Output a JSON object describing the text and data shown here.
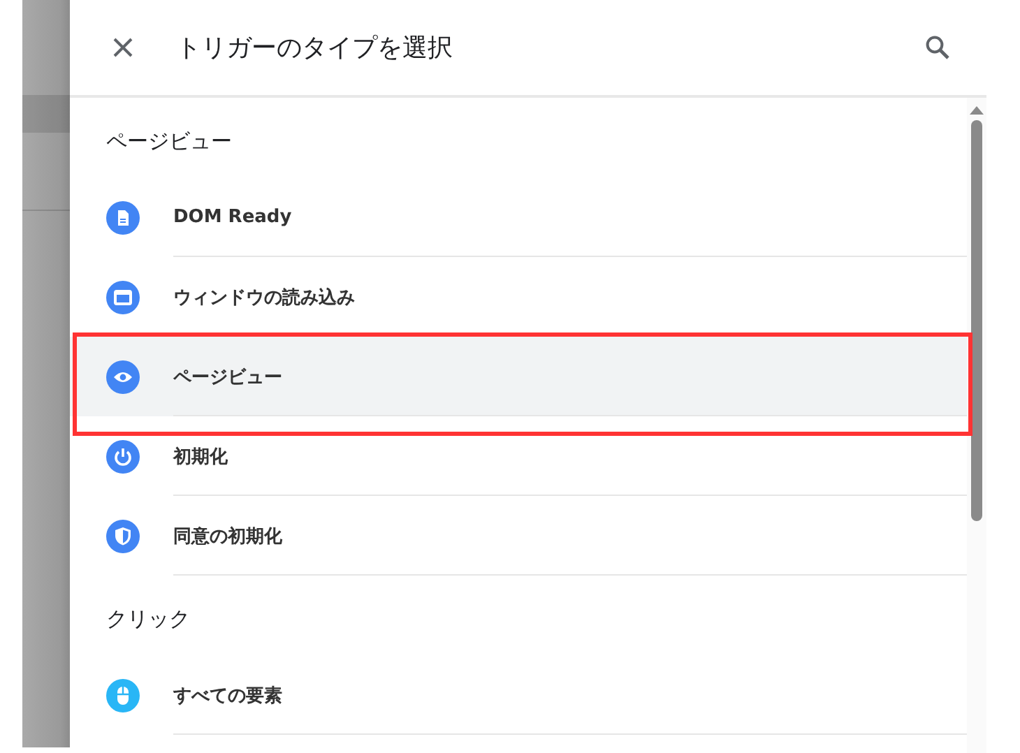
{
  "dialog": {
    "title": "トリガーのタイプを選択"
  },
  "sections": [
    {
      "title": "ページビュー",
      "items": [
        {
          "label": "DOM Ready",
          "kind": "document",
          "color": "#4285f4",
          "selected": false,
          "highlighted": false
        },
        {
          "label": "ウィンドウの読み込み",
          "kind": "window",
          "color": "#4285f4",
          "selected": false,
          "highlighted": false
        },
        {
          "label": "ページビュー",
          "kind": "eye",
          "color": "#4285f4",
          "selected": true,
          "highlighted": true
        },
        {
          "label": "初期化",
          "kind": "power",
          "color": "#4285f4",
          "selected": false,
          "highlighted": false
        },
        {
          "label": "同意の初期化",
          "kind": "shield",
          "color": "#4285f4",
          "selected": false,
          "highlighted": false
        }
      ]
    },
    {
      "title": "クリック",
      "items": [
        {
          "label": "すべての要素",
          "kind": "mouse",
          "color": "#29b6f6",
          "selected": false,
          "highlighted": false
        }
      ]
    }
  ]
}
